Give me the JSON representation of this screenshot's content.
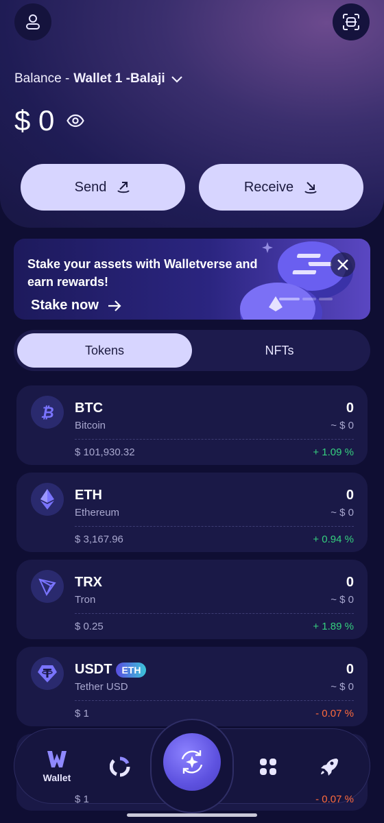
{
  "header": {
    "profile_icon": "user-icon",
    "scan_icon": "scan-icon",
    "balance_prefix": "Balance - ",
    "wallet_name": "Wallet 1 -Balaji",
    "balance_amount": "$ 0",
    "visibility_icon": "eye-icon"
  },
  "actions": {
    "send_label": "Send",
    "receive_label": "Receive"
  },
  "banner": {
    "text": "Stake your assets with Walletverse and earn rewards!",
    "cta": "Stake now",
    "pages": 3,
    "active_page": 1
  },
  "tabs": {
    "tokens": "Tokens",
    "nfts": "NFTs"
  },
  "tokens": [
    {
      "symbol": "BTC",
      "name": "Bitcoin",
      "balance": "0",
      "fiat": "~ $ 0",
      "price": "$ 101,930.32",
      "change": "+ 1.09 %",
      "direction": "up",
      "icon": "bitcoin-icon"
    },
    {
      "symbol": "ETH",
      "name": "Ethereum",
      "balance": "0",
      "fiat": "~ $ 0",
      "price": "$ 3,167.96",
      "change": "+ 0.94 %",
      "direction": "up",
      "icon": "ethereum-icon"
    },
    {
      "symbol": "TRX",
      "name": "Tron",
      "balance": "0",
      "fiat": "~ $ 0",
      "price": "$ 0.25",
      "change": "+ 1.89 %",
      "direction": "up",
      "icon": "tron-icon"
    },
    {
      "symbol": "USDT",
      "chip": "ETH",
      "name": "Tether USD",
      "balance": "0",
      "fiat": "~ $ 0",
      "price": "$ 1",
      "change": "- 0.07 %",
      "direction": "down",
      "icon": "tether-icon"
    }
  ],
  "partial_row": {
    "price": "$ 1",
    "change": "- 0.07 %"
  },
  "bottom_nav": {
    "wallet_label": "Wallet",
    "items": [
      "wallet-icon",
      "chart-ring-icon",
      "swap-icon",
      "apps-grid-icon",
      "rocket-icon"
    ]
  },
  "colors": {
    "background": "#0f0e33",
    "accent_button": "#d7d5ff",
    "positive": "#35d07f",
    "negative": "#ff6b3d"
  }
}
